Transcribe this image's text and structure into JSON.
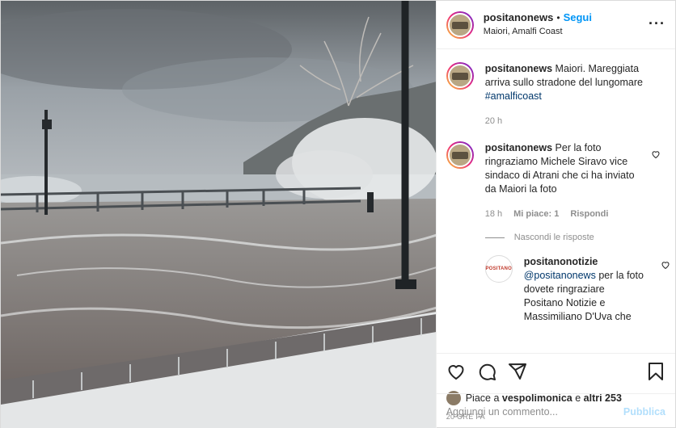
{
  "header": {
    "username": "positanonews",
    "separator": "•",
    "follow_label": "Segui",
    "location": "Maiori, Amalfi Coast",
    "more_label": "···"
  },
  "caption": {
    "username": "positanonews",
    "text": "Maiori. Mareggiata arriva sullo stradone del lungomare",
    "hashtag": "#amalficoast",
    "time": "20 h"
  },
  "comment": {
    "username": "positanonews",
    "text": "Per la foto ringraziamo Michele Siravo vice sindaco di Atrani che ci ha inviato da Maiori la foto",
    "time": "18 h",
    "likes": "Mi piace: 1",
    "reply_label": "Rispondi"
  },
  "hide_replies_label": "Nascondi le risposte",
  "reply": {
    "username": "positanonotizie",
    "mention": "@positanonews",
    "text": "per la foto dovete ringraziare Positano Notizie e Massimiliano D'Uva che",
    "avatar_text": "POSITANO"
  },
  "likes": {
    "prefix": "Piace a",
    "user": "vespolimonica",
    "middle": "e",
    "others": "altri 253"
  },
  "post_time": "20 ORE FA",
  "add_comment": {
    "placeholder": "Aggiungi un commento...",
    "publish_label": "Pubblica"
  },
  "colors": {
    "accent": "#0095f6",
    "publish_disabled": "#b2dffc",
    "muted": "#8e8e8e",
    "text": "#262626"
  },
  "icons": [
    "heart-icon",
    "comment-icon",
    "share-icon",
    "bookmark-icon",
    "more-icon"
  ]
}
